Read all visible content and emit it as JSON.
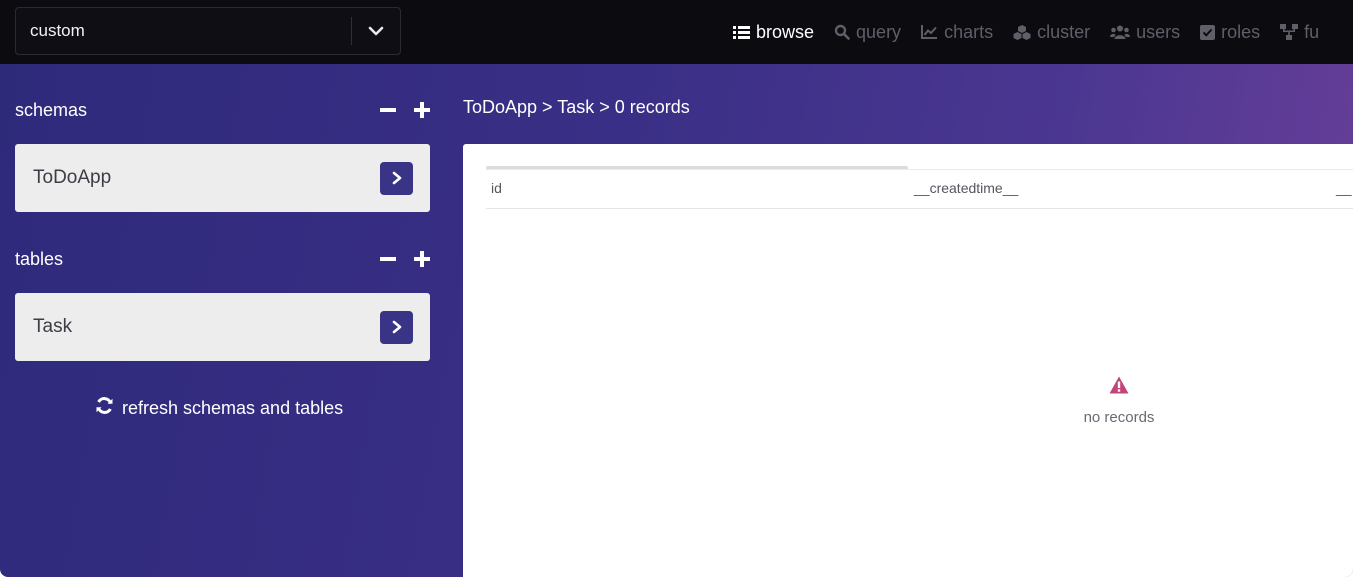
{
  "header": {
    "environment_value": "custom",
    "nav": [
      {
        "label": "browse",
        "icon": "list-icon",
        "active": true
      },
      {
        "label": "query",
        "icon": "search-icon",
        "active": false
      },
      {
        "label": "charts",
        "icon": "line-chart-icon",
        "active": false
      },
      {
        "label": "cluster",
        "icon": "cubes-icon",
        "active": false
      },
      {
        "label": "users",
        "icon": "users-icon",
        "active": false
      },
      {
        "label": "roles",
        "icon": "checkbox-icon",
        "active": false
      },
      {
        "label": "fu",
        "icon": "sitemap-icon",
        "active": false
      }
    ]
  },
  "sidebar": {
    "schemas_title": "schemas",
    "schemas": [
      {
        "label": "ToDoApp"
      }
    ],
    "tables_title": "tables",
    "tables": [
      {
        "label": "Task"
      }
    ],
    "refresh_label": "refresh schemas and tables"
  },
  "main": {
    "breadcrumb": "ToDoApp > Task > 0 records",
    "columns": [
      "id",
      "__createdtime__",
      "__"
    ],
    "empty_message": "no records"
  },
  "colors": {
    "accent": "#3a3487",
    "warning": "#c2457a",
    "topbar": "#0b0b10"
  }
}
